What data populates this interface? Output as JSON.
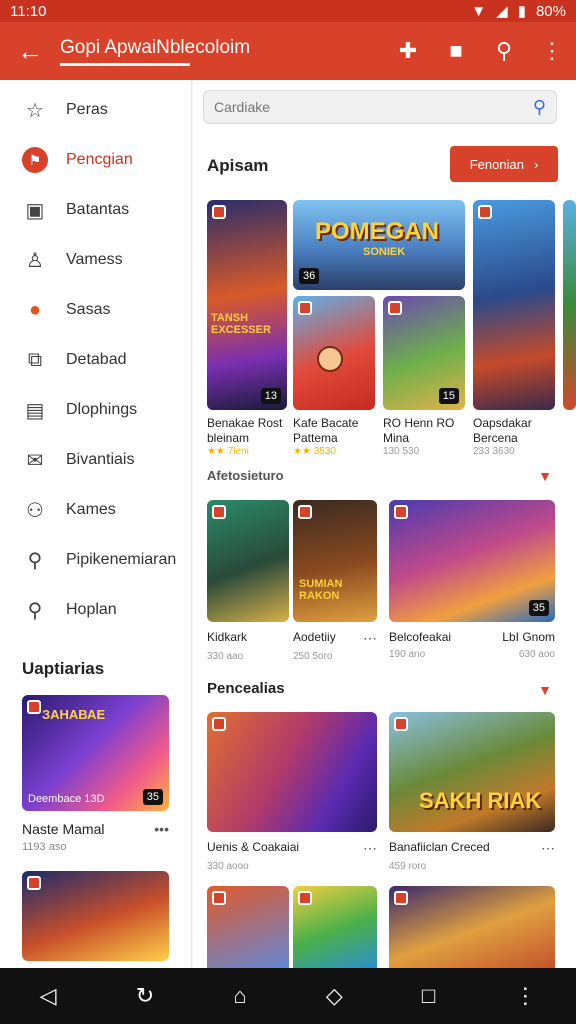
{
  "status": {
    "time": "11:10",
    "battery": "80%"
  },
  "appbar": {
    "title": "Gopi ApwaiNblecoloim",
    "icons": [
      "back-icon",
      "add-icon",
      "folder-icon",
      "search-icon",
      "more-icon"
    ]
  },
  "sidebar": {
    "items": [
      {
        "label": "Peras",
        "icon": "star-icon"
      },
      {
        "label": "Pencgian",
        "icon": "flag-icon"
      },
      {
        "label": "Batantas",
        "icon": "box-icon"
      },
      {
        "label": "Vamess",
        "icon": "user-icon"
      },
      {
        "label": "Sasas",
        "icon": "avatar-icon"
      },
      {
        "label": "Detabad",
        "icon": "puzzle-icon"
      },
      {
        "label": "Dlophings",
        "icon": "document-icon"
      },
      {
        "label": "Bivantiais",
        "icon": "mail-icon"
      },
      {
        "label": "Kames",
        "icon": "people-icon"
      },
      {
        "label": "Pipikenemiaran",
        "icon": "search-icon"
      },
      {
        "label": "Hoplan",
        "icon": "pin-icon"
      }
    ],
    "section_title": "Uaptiarias",
    "cards": [
      {
        "title": "Naste Mamal",
        "sub": "1193 aso",
        "badge": "35",
        "caption": "Deembace 13D"
      },
      {
        "title": "",
        "sub": "",
        "badge": "",
        "caption": ""
      }
    ]
  },
  "main": {
    "search_placeholder": "Cardiake",
    "section1": {
      "title": "Apisam",
      "button": "Fenonian"
    },
    "row1": [
      {
        "title": "Benakae Rost bleinam",
        "sub": "★★ 7leni",
        "badge": "13",
        "art": "TANSH EXCESSER"
      },
      {
        "title": "Kafe Bacate Pattema",
        "sub": "★★ 3530",
        "badge": "36",
        "art": "POMEGAN"
      },
      {
        "title": "RO Henn RO Mina",
        "sub": "130 530",
        "badge": "15",
        "art": ""
      },
      {
        "title": "Oapsdakar Bercena",
        "sub": "233 3630",
        "badge": "",
        "art": ""
      }
    ],
    "row2_title": "Afetosieturo",
    "row2": [
      {
        "title": "Kidkark",
        "sub": "330 aao",
        "art": ""
      },
      {
        "title": "Aodetiiy",
        "sub": "250 5oro",
        "art": "SUMIAN RAKON"
      },
      {
        "title": "Belcofeakai",
        "sub": "190 ano",
        "art": ""
      },
      {
        "title": "LbI Gnom",
        "sub": "630 aoo",
        "art": ""
      }
    ],
    "section3": {
      "title": "Pencealias"
    },
    "row3": [
      {
        "title": "Uenis & Coakaiai",
        "sub": "330 aooo",
        "art": ""
      },
      {
        "title": "Banafiiclan Creced",
        "sub": "459 roro",
        "art": "SAKH RIAK"
      }
    ]
  },
  "navbar": {
    "icons": [
      "back-nav-icon",
      "rotate-icon",
      "home-icon",
      "diamond-icon",
      "recents-icon",
      "more-icon"
    ]
  },
  "colors": {
    "accent": "#d8412a",
    "statusbar": "#c8321f"
  }
}
